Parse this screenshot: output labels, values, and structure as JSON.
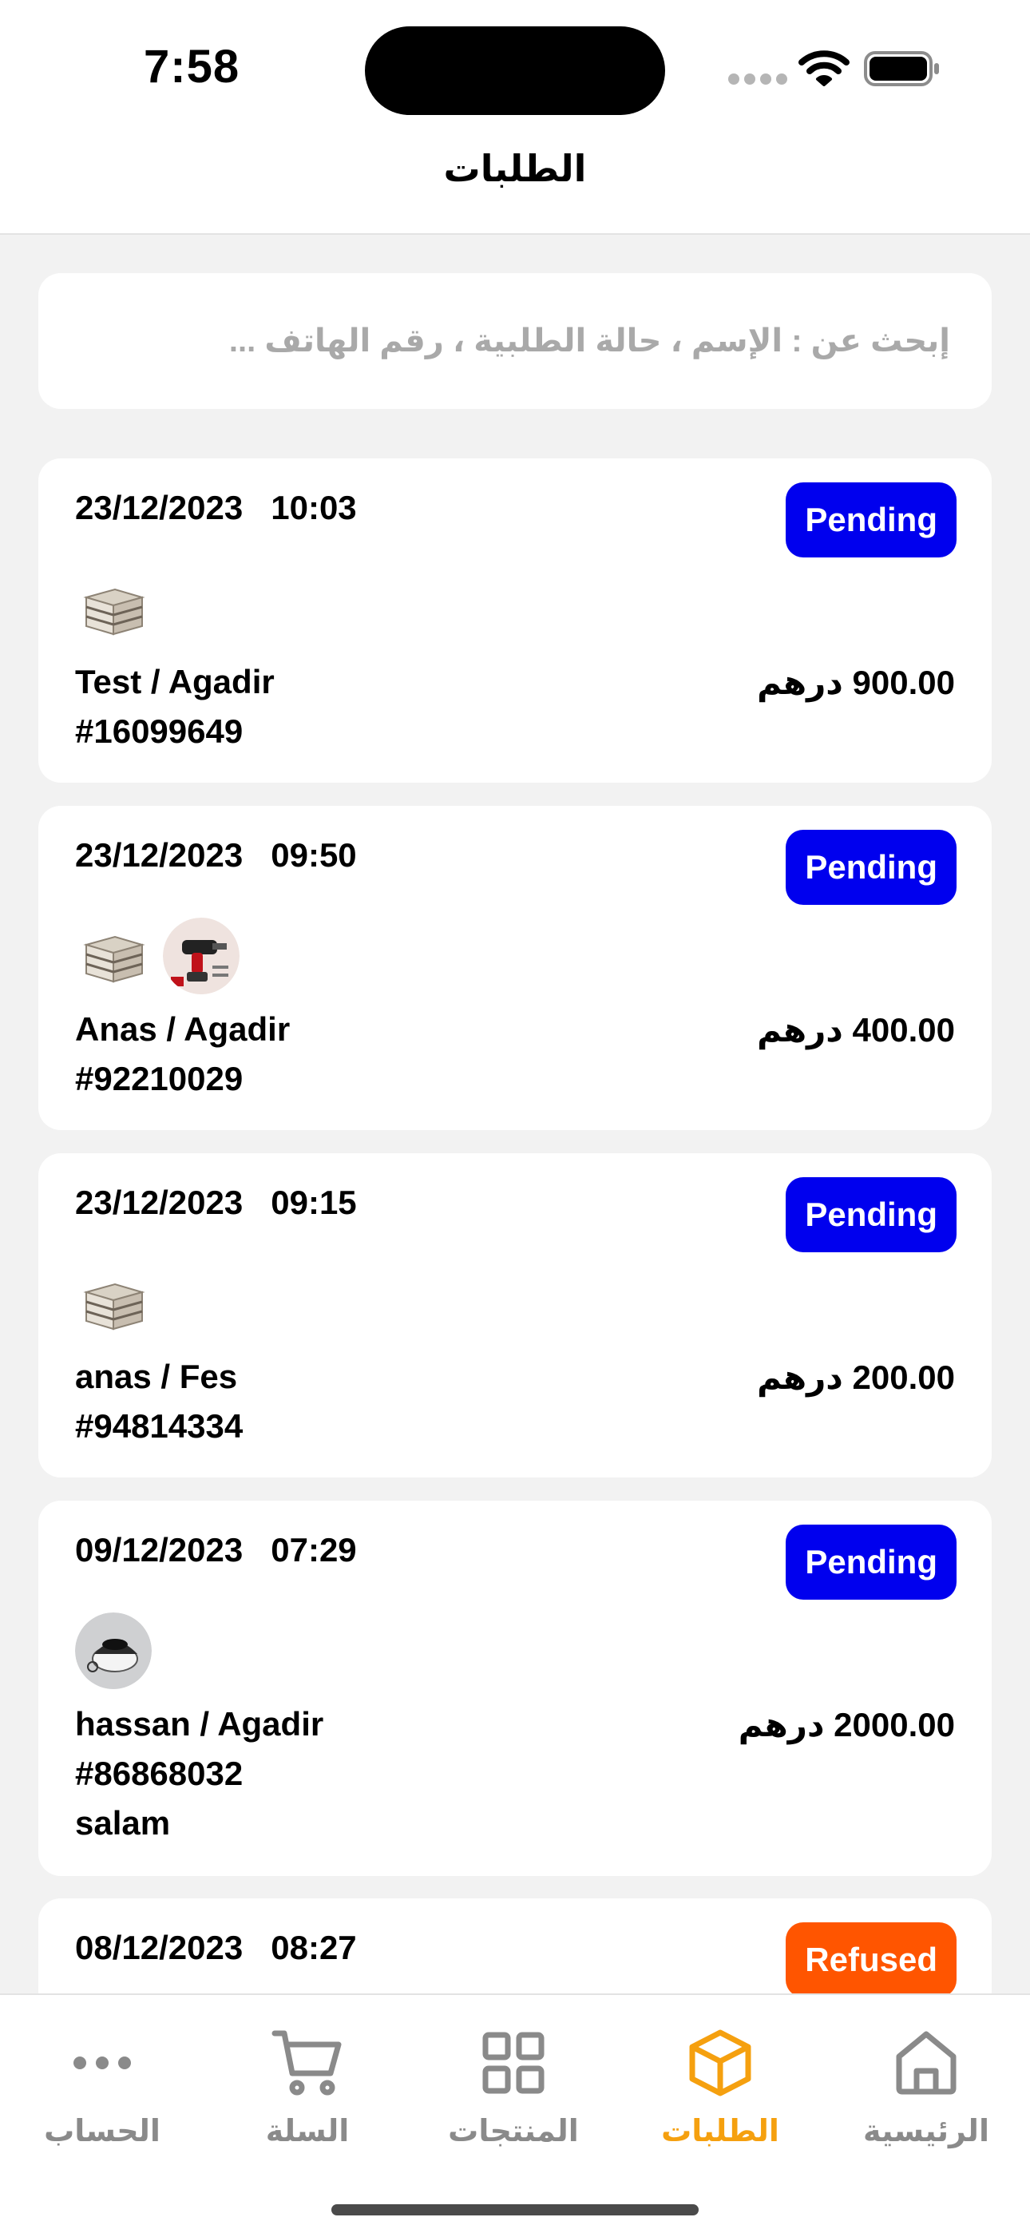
{
  "status_bar": {
    "time": "7:58"
  },
  "header": {
    "title": "الطلبات"
  },
  "search": {
    "placeholder": "إبحث عن : الإسم ، حالة الطلبية ، رقم الهاتف ..."
  },
  "orders": [
    {
      "date": "23/12/2023",
      "time": "10:03",
      "status": "Pending",
      "customer": "Test / Agadir",
      "number": "#16099649",
      "amount": "900.00 درهم",
      "note": "",
      "products": [
        "storage-box"
      ]
    },
    {
      "date": "23/12/2023",
      "time": "09:50",
      "status": "Pending",
      "customer": "Anas / Agadir",
      "number": "#92210029",
      "amount": "400.00 درهم",
      "note": "",
      "products": [
        "storage-box",
        "power-drill"
      ]
    },
    {
      "date": "23/12/2023",
      "time": "09:15",
      "status": "Pending",
      "customer": "anas / Fes",
      "number": "#94814334",
      "amount": "200.00 درهم",
      "note": "",
      "products": [
        "storage-box"
      ]
    },
    {
      "date": "09/12/2023",
      "time": "07:29",
      "status": "Pending",
      "customer": "hassan / Agadir",
      "number": "#86868032",
      "amount": "2000.00 درهم",
      "note": "salam",
      "products": [
        "robot-vacuum"
      ]
    },
    {
      "date": "08/12/2023",
      "time": "08:27",
      "status": "Refused",
      "customer": "",
      "number": "",
      "amount": "",
      "note": "",
      "products": []
    }
  ],
  "colors": {
    "pending": "#0000ee",
    "refused": "#ff5500",
    "active_tab": "#f5a00f",
    "inactive_tab": "#8a8a8a"
  },
  "tabs": [
    {
      "label": "الحساب",
      "icon": "more-icon"
    },
    {
      "label": "السلة",
      "icon": "cart-icon"
    },
    {
      "label": "المنتجات",
      "icon": "grid-icon"
    },
    {
      "label": "الطلبات",
      "icon": "box-icon",
      "active": true
    },
    {
      "label": "الرئيسية",
      "icon": "home-icon"
    }
  ]
}
